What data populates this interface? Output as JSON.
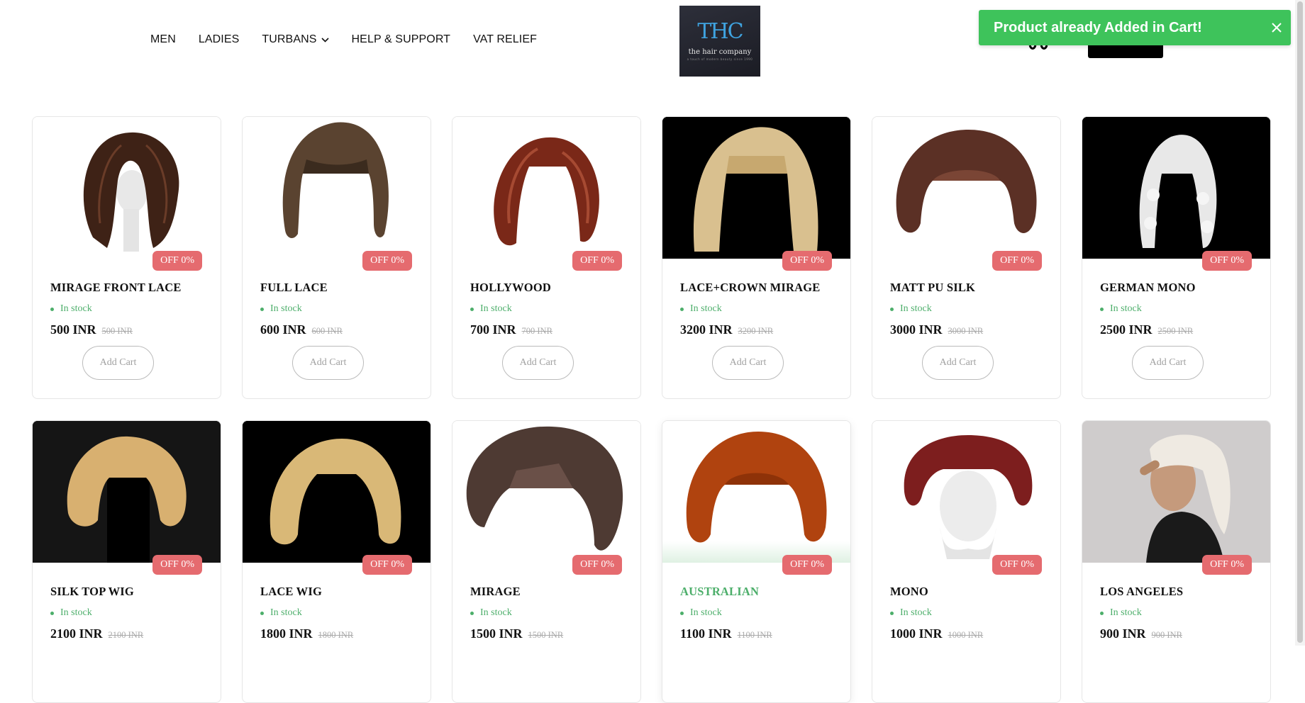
{
  "nav": {
    "men": "MEN",
    "ladies": "LADIES",
    "turbans": "TURBANS",
    "help": "HELP & SUPPORT",
    "vat": "VAT RELIEF"
  },
  "logo": {
    "mono": "THC",
    "name": "the hair company",
    "tagline": "a touch of modern beauty since 1990"
  },
  "toast": {
    "message": "Product already Added in Cart!"
  },
  "colors": {
    "toast": "#3ec35b",
    "badge": "#e56b6f",
    "in_stock": "#4cae6a"
  },
  "products": [
    {
      "name": "MIRAGE FRONT LACE",
      "badge": "OFF 0%",
      "stock": "In stock",
      "price": "500 INR",
      "old_price": "500 INR",
      "button": "Add Cart"
    },
    {
      "name": "FULL LACE",
      "badge": "OFF 0%",
      "stock": "In stock",
      "price": "600 INR",
      "old_price": "600 INR",
      "button": "Add Cart"
    },
    {
      "name": "HOLLYWOOD",
      "badge": "OFF 0%",
      "stock": "In stock",
      "price": "700 INR",
      "old_price": "700 INR",
      "button": "Add Cart"
    },
    {
      "name": "LACE+CROWN MIRAGE",
      "badge": "OFF 0%",
      "stock": "In stock",
      "price": "3200 INR",
      "old_price": "3200 INR",
      "button": "Add Cart"
    },
    {
      "name": "MATT PU SILK",
      "badge": "OFF 0%",
      "stock": "In stock",
      "price": "3000 INR",
      "old_price": "3000 INR",
      "button": "Add Cart"
    },
    {
      "name": "GERMAN MONO",
      "badge": "OFF 0%",
      "stock": "In stock",
      "price": "2500 INR",
      "old_price": "2500 INR",
      "button": "Add Cart"
    },
    {
      "name": "SILK TOP WIG",
      "badge": "OFF 0%",
      "stock": "In stock",
      "price": "2100 INR",
      "old_price": "2100 INR"
    },
    {
      "name": "LACE WIG",
      "badge": "OFF 0%",
      "stock": "In stock",
      "price": "1800 INR",
      "old_price": "1800 INR"
    },
    {
      "name": "MIRAGE",
      "badge": "OFF 0%",
      "stock": "In stock",
      "price": "1500 INR",
      "old_price": "1500 INR"
    },
    {
      "name": "AUSTRALIAN",
      "badge": "OFF 0%",
      "stock": "In stock",
      "price": "1100 INR",
      "old_price": "1100 INR"
    },
    {
      "name": "MONO",
      "badge": "OFF 0%",
      "stock": "In stock",
      "price": "1000 INR",
      "old_price": "1000 INR"
    },
    {
      "name": "LOS ANGELES",
      "badge": "OFF 0%",
      "stock": "In stock",
      "price": "900 INR",
      "old_price": "900 INR"
    }
  ]
}
